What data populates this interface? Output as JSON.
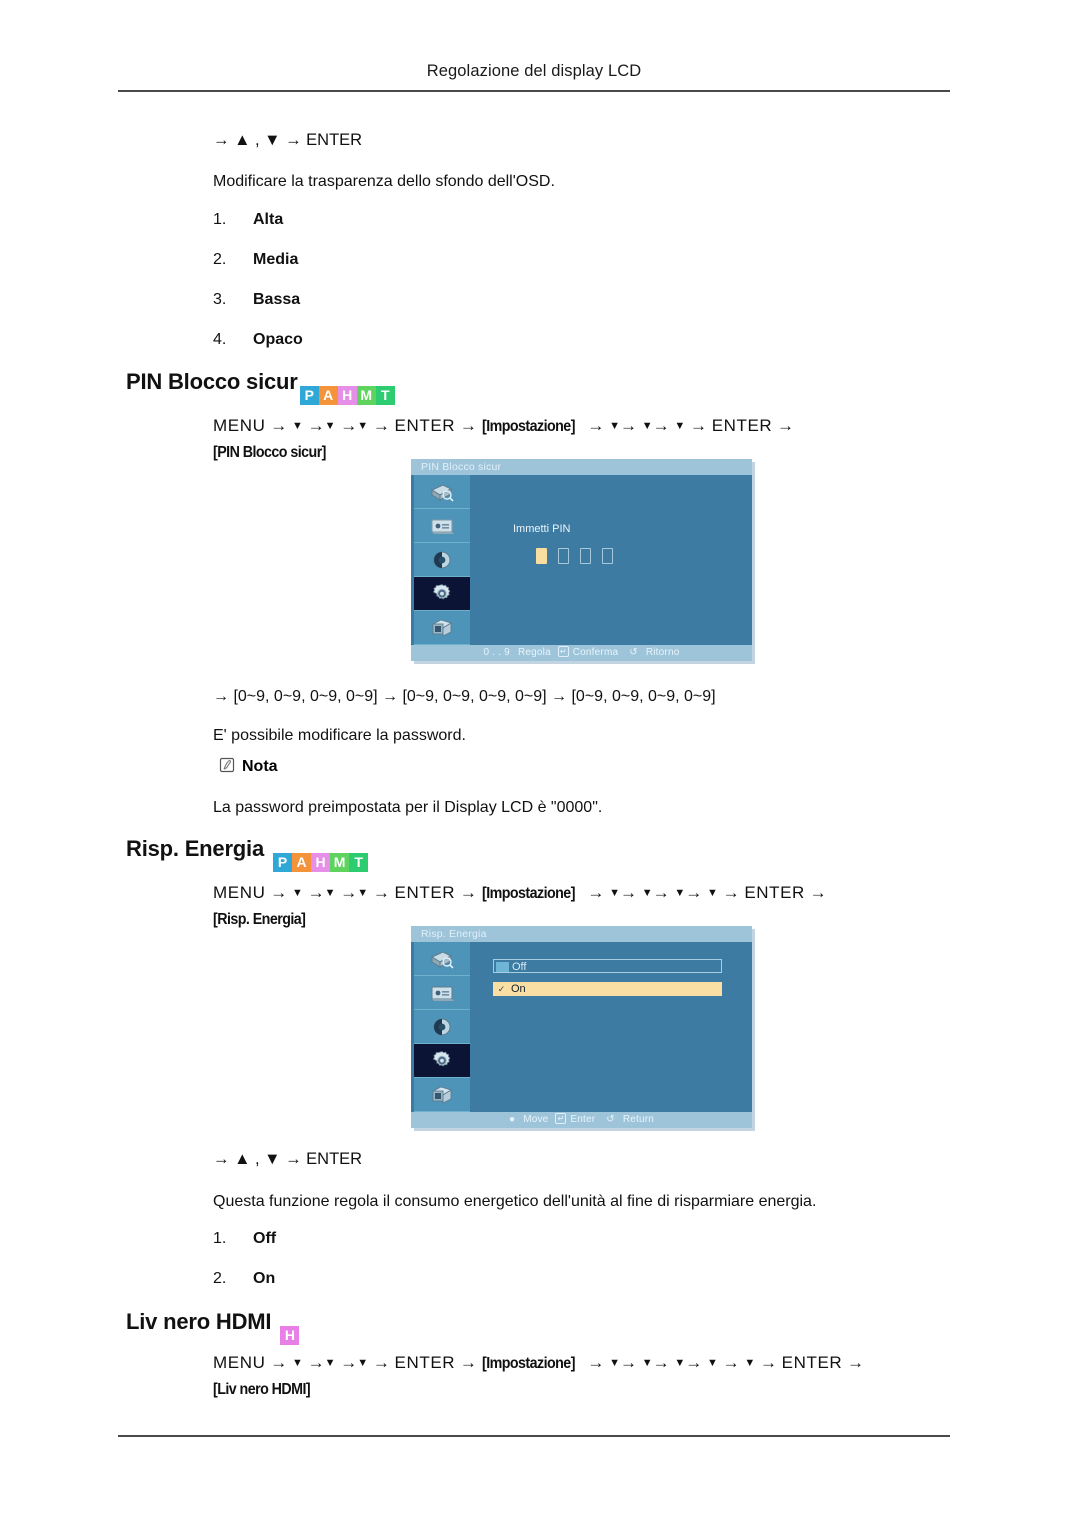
{
  "header": {
    "title": "Regolazione del display LCD"
  },
  "osd_transparency": {
    "keypath": "→ ▲ , ▼ → ENTER",
    "description": "Modificare la trasparenza dello sfondo dell'OSD.",
    "options": [
      {
        "num": "1.",
        "label": "Alta"
      },
      {
        "num": "2.",
        "label": "Media"
      },
      {
        "num": "3.",
        "label": "Bassa"
      },
      {
        "num": "4.",
        "label": "Opaco"
      }
    ]
  },
  "pin_section": {
    "heading": "PIN Blocco sicur",
    "badges": [
      {
        "letter": "P",
        "color": "#2fa8d8"
      },
      {
        "letter": "A",
        "color": "#f5933a"
      },
      {
        "letter": "H",
        "color": "#e58fe8"
      },
      {
        "letter": "M",
        "color": "#5ed45e"
      },
      {
        "letter": "T",
        "color": "#2ecc71"
      }
    ],
    "menu_path": {
      "menu": "MENU",
      "enter": "ENTER",
      "condition_1": "[Impostazione]",
      "condition_2": "[PIN Blocco sicur]",
      "arrow": "→",
      "down": "▼"
    },
    "osd": {
      "title": "PIN Blocco sicur",
      "prompt": "Immetti PIN",
      "pin_digits": [
        true,
        false,
        false,
        false
      ],
      "footer": {
        "range_label": "0 . . 9",
        "adjust": "Regola",
        "confirm": "Conferma",
        "return": "Ritorno"
      },
      "sidebar_icons": [
        "input-source-icon",
        "picture-icon",
        "contrast-icon",
        "setup-gear-icon",
        "multi-control-icon"
      ],
      "selected_icon_index": 3
    },
    "range_line": "→ [0~9, 0~9, 0~9, 0~9] → [0~9, 0~9, 0~9, 0~9] → [0~9, 0~9, 0~9, 0~9]",
    "password_note": "E' possibile modificare la password.",
    "nota_label": "Nota",
    "nota_text": "La password preimpostata per il Display LCD è \"0000\"."
  },
  "energy_section": {
    "heading": "Risp. Energia",
    "badges": [
      {
        "letter": "P",
        "color": "#2fa8d8"
      },
      {
        "letter": "A",
        "color": "#f5933a"
      },
      {
        "letter": "H",
        "color": "#e58fe8"
      },
      {
        "letter": "M",
        "color": "#5ed45e"
      },
      {
        "letter": "T",
        "color": "#2ecc71"
      }
    ],
    "menu_path": {
      "menu": "MENU",
      "enter": "ENTER",
      "condition_1": "[Impostazione]",
      "condition_2": "[Risp. Energia]",
      "arrow": "→",
      "down": "▼"
    },
    "osd": {
      "title": "Risp. Energia",
      "options": [
        {
          "label": "Off",
          "selected": false
        },
        {
          "label": "On",
          "selected": true
        }
      ],
      "footer": {
        "move": "Move",
        "enter": "Enter",
        "return": "Return"
      },
      "sidebar_icons": [
        "input-source-icon",
        "picture-icon",
        "contrast-icon",
        "setup-gear-icon",
        "multi-control-icon"
      ],
      "selected_icon_index": 3
    },
    "keypath": "→ ▲ , ▼ → ENTER",
    "description": "Questa funzione regola il consumo energetico dell'unità al fine di risparmiare energia.",
    "options": [
      {
        "num": "1.",
        "label": "Off"
      },
      {
        "num": "2.",
        "label": "On"
      }
    ]
  },
  "hdmi_section": {
    "heading": "Liv nero HDMI",
    "badges": [
      {
        "letter": "H",
        "color": "#e77fe7"
      }
    ],
    "menu_path": {
      "menu": "MENU",
      "enter": "ENTER",
      "condition_1": "[Impostazione]",
      "condition_2": "[Liv nero HDMI]",
      "arrow": "→",
      "down": "▼"
    }
  }
}
